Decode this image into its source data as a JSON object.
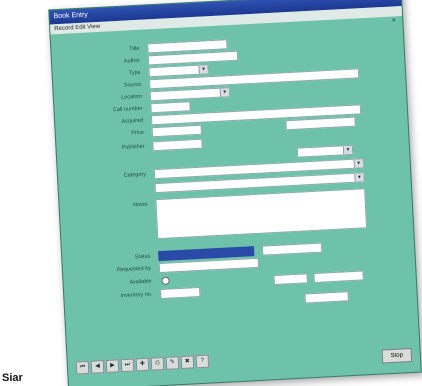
{
  "window": {
    "title": "Book Entry",
    "menu": "Record  Edit  View",
    "close_glyph": "×"
  },
  "form": {
    "labels": {
      "title": "Title",
      "author": "Author",
      "type": "Type",
      "source": "Source",
      "location": "Location",
      "call": "Call number",
      "acquired": "Acquired",
      "price": "Price",
      "publisher": "Publisher",
      "category": "Category",
      "notes": "Notes",
      "status": "Status",
      "requested_by": "Requested by",
      "available": "Available",
      "inventory": "Inventory no."
    },
    "values": {
      "title": "",
      "author": "",
      "type": "",
      "source": "",
      "location": "",
      "call": "",
      "acquired": "",
      "price": "",
      "publisher": "",
      "category": "",
      "notes": "",
      "status": "",
      "requested_by": "",
      "inventory": "",
      "code": "",
      "condition": ""
    }
  },
  "buttons": {
    "stop": "Stop"
  },
  "caption": "Siar"
}
